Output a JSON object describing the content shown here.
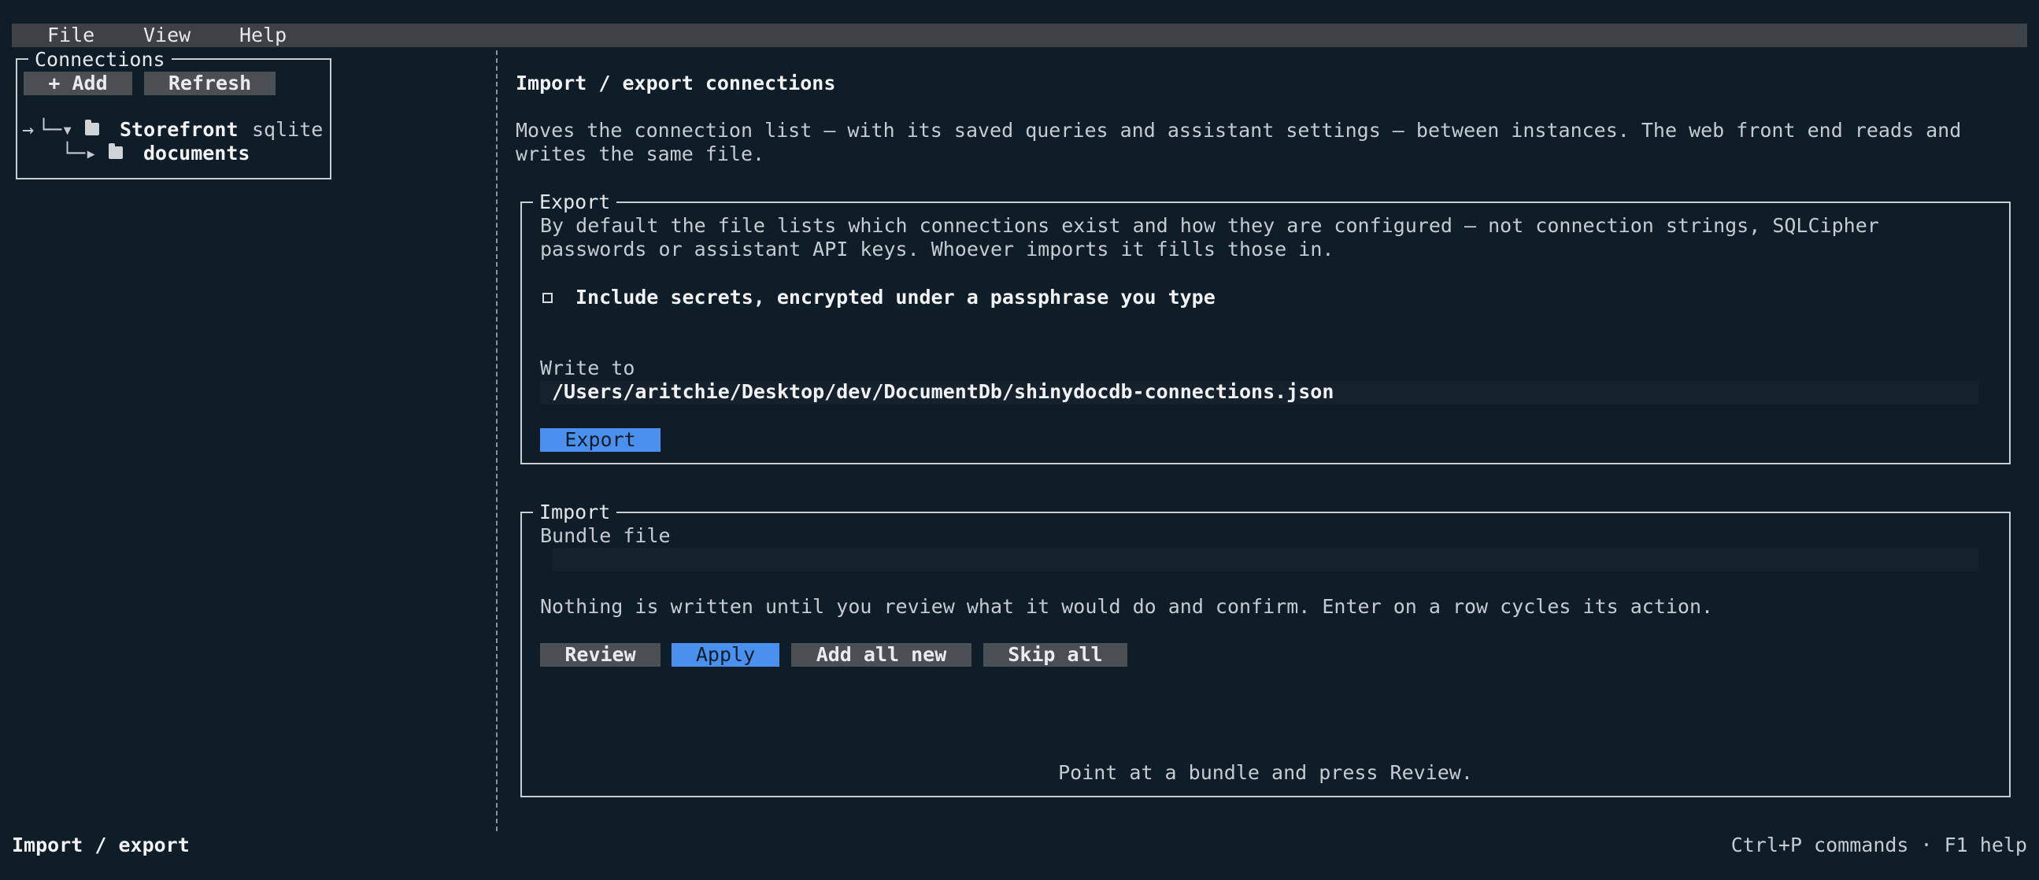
{
  "menu": {
    "file": "File",
    "view": "View",
    "help": "Help"
  },
  "sidebar": {
    "title": "Connections",
    "add_label": "+ Add",
    "refresh_label": "Refresh",
    "tree": {
      "cursor_glyph": "→",
      "branch1_glyph": "└─▾",
      "connection_name": "Storefront",
      "connection_type": "sqlite",
      "branch2_glyph": "└─▸",
      "collection_name": "documents"
    }
  },
  "main": {
    "heading": "Import / export connections",
    "description_line1": "Moves the connection list – with its saved queries and assistant settings – between instances. The web front end reads and",
    "description_line2": "writes the same file.",
    "export": {
      "title": "Export",
      "info_line1": "By default the file lists which connections exist and how they are configured – not connection strings, SQLCipher",
      "info_line2": "passwords or assistant API keys. Whoever imports it fills those in.",
      "include_secrets_label": "Include secrets, encrypted under a passphrase you type",
      "include_secrets_checked": false,
      "write_to_label": "Write to",
      "path_value": "/Users/aritchie/Desktop/dev/DocumentDb/shinydocdb-connections.json",
      "export_button": "Export"
    },
    "import": {
      "title": "Import",
      "bundle_label": "Bundle file",
      "bundle_value": "",
      "info": "Nothing is written until you review what it would do and confirm. Enter on a row cycles its action.",
      "review_button": "Review",
      "apply_button": "Apply",
      "add_all_new_button": "Add all new",
      "skip_all_button": "Skip all",
      "status": "Point at a bundle and press Review."
    }
  },
  "statusbar": {
    "left": "Import / export",
    "right": "Ctrl+P commands · F1 help"
  },
  "colors": {
    "background": "#0f1d29",
    "accent": "#4a90ef",
    "button": "#4a4f53",
    "menubar": "#3d4246"
  }
}
